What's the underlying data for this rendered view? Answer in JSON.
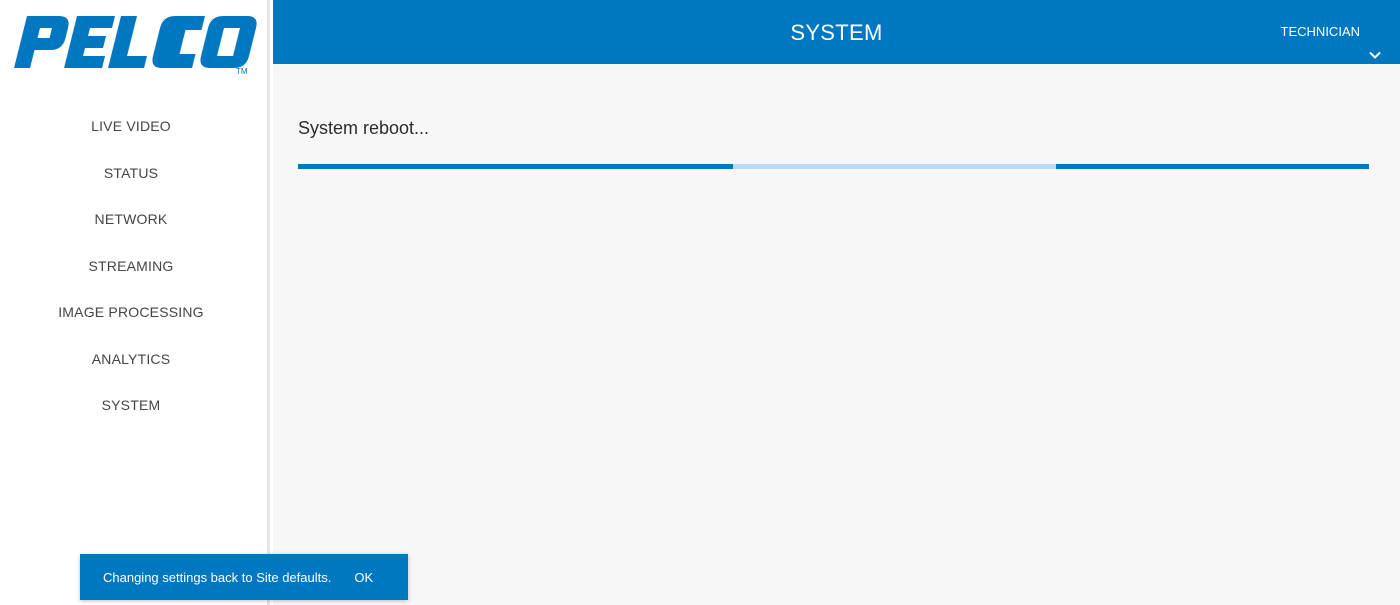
{
  "brand": {
    "logo_text": "PELCO",
    "trademark": "TM",
    "color": "#0078c1"
  },
  "sidebar": {
    "items": [
      {
        "label": "LIVE VIDEO"
      },
      {
        "label": "STATUS"
      },
      {
        "label": "NETWORK"
      },
      {
        "label": "STREAMING"
      },
      {
        "label": "IMAGE PROCESSING"
      },
      {
        "label": "ANALYTICS"
      },
      {
        "label": "SYSTEM"
      }
    ]
  },
  "header": {
    "title": "SYSTEM",
    "user_label": "TECHNICIAN",
    "user_icon": "chevron-down-icon",
    "background": "#0078c1"
  },
  "main": {
    "status_text": "System reboot...",
    "progress": {
      "state": "indeterminate",
      "bar_color": "#0078c1",
      "track_color": "#b9dcf4"
    }
  },
  "snackbar": {
    "message": "Changing settings back to Site defaults.",
    "action_label": "OK"
  }
}
